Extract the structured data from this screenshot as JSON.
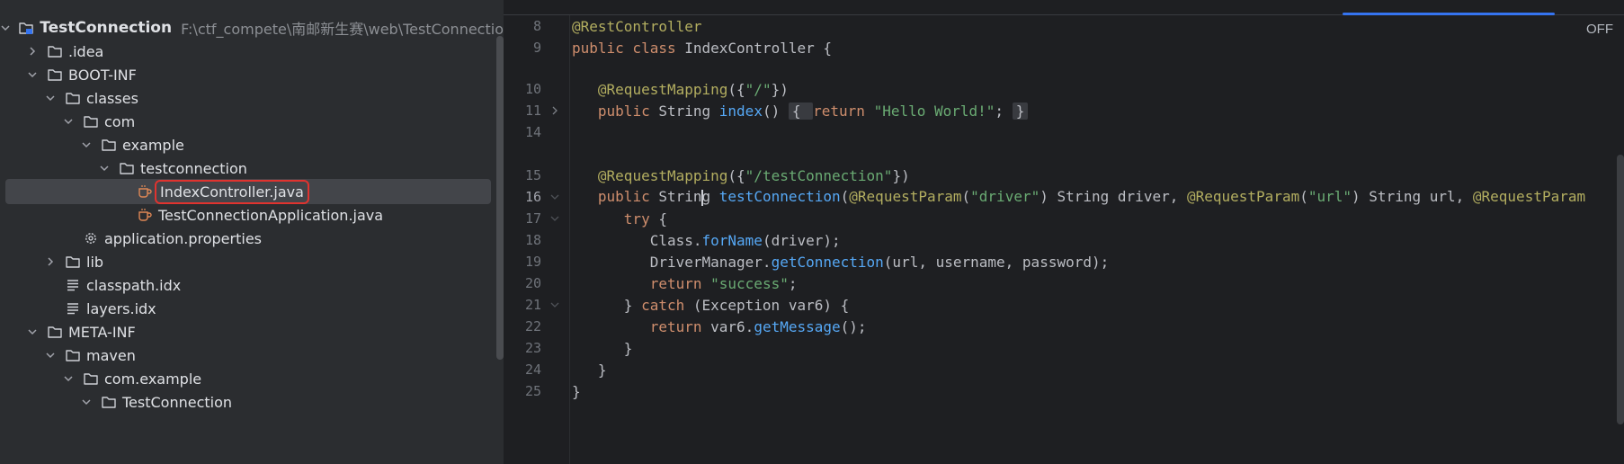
{
  "project_tree": {
    "items": [
      {
        "label": "TestConnection",
        "path": "F:\\ctf_compete\\南邮新生赛\\web\\TestConnectio",
        "icon": "module-folder-icon",
        "expanded": true,
        "depth": 0
      },
      {
        "label": ".idea",
        "icon": "folder-icon",
        "expanded": false,
        "depth": 1
      },
      {
        "label": "BOOT-INF",
        "icon": "folder-icon",
        "expanded": true,
        "depth": 1
      },
      {
        "label": "classes",
        "icon": "folder-icon",
        "expanded": true,
        "depth": 2
      },
      {
        "label": "com",
        "icon": "folder-icon",
        "expanded": true,
        "depth": 3
      },
      {
        "label": "example",
        "icon": "folder-icon",
        "expanded": true,
        "depth": 4
      },
      {
        "label": "testconnection",
        "icon": "folder-icon",
        "expanded": true,
        "depth": 5
      },
      {
        "label": "IndexController.java",
        "icon": "java-class-icon",
        "depth": 6,
        "selected": true,
        "highlighted": true
      },
      {
        "label": "TestConnectionApplication.java",
        "icon": "java-class-icon",
        "depth": 6
      },
      {
        "label": "application.properties",
        "icon": "settings-file-icon",
        "depth": 3
      },
      {
        "label": "lib",
        "icon": "folder-icon",
        "expanded": false,
        "depth": 2
      },
      {
        "label": "classpath.idx",
        "icon": "text-file-icon",
        "depth": 2
      },
      {
        "label": "layers.idx",
        "icon": "text-file-icon",
        "depth": 2
      },
      {
        "label": "META-INF",
        "icon": "folder-icon",
        "expanded": true,
        "depth": 1
      },
      {
        "label": "maven",
        "icon": "folder-icon",
        "expanded": true,
        "depth": 2
      },
      {
        "label": "com.example",
        "icon": "folder-icon",
        "expanded": true,
        "depth": 3
      },
      {
        "label": "TestConnection",
        "icon": "folder-icon",
        "expanded": true,
        "depth": 4
      }
    ]
  },
  "editor": {
    "reader_mode_label": "OFF",
    "current_line": "16",
    "lines": [
      {
        "no": "8",
        "tokens": [
          [
            "ann",
            "@RestController"
          ]
        ]
      },
      {
        "no": "9",
        "tokens": [
          [
            "kw",
            "public class "
          ],
          [
            "",
            "IndexController {"
          ]
        ]
      },
      {
        "no": "",
        "tokens": []
      },
      {
        "no": "10",
        "tokens": [
          [
            "",
            "   "
          ],
          [
            "ann",
            "@RequestMapping"
          ],
          [
            "",
            "({"
          ],
          [
            "str",
            "\"/\""
          ],
          [
            "",
            "})"
          ]
        ]
      },
      {
        "no": "11",
        "fold": "right",
        "tokens": [
          [
            "",
            "   "
          ],
          [
            "kw",
            "public "
          ],
          [
            "",
            "String "
          ],
          [
            "fn",
            "index"
          ],
          [
            "",
            "() "
          ],
          [
            "foldbox",
            "{ "
          ],
          [
            "kw",
            "return "
          ],
          [
            "str",
            "\"Hello World!\""
          ],
          [
            "",
            "; "
          ],
          [
            "foldbox",
            "}"
          ]
        ]
      },
      {
        "no": "14",
        "tokens": []
      },
      {
        "no": "",
        "tokens": []
      },
      {
        "no": "15",
        "tokens": [
          [
            "",
            "   "
          ],
          [
            "ann",
            "@RequestMapping"
          ],
          [
            "",
            "({"
          ],
          [
            "str",
            "\"/testConnection\""
          ],
          [
            "",
            "})"
          ]
        ]
      },
      {
        "no": "16",
        "fold": "down",
        "tokens": [
          [
            "",
            "   "
          ],
          [
            "kw",
            "public "
          ],
          [
            "",
            "Strin"
          ],
          [
            "caret",
            ""
          ],
          [
            "",
            "g "
          ],
          [
            "fn",
            "testConnection"
          ],
          [
            "",
            "("
          ],
          [
            "ann",
            "@RequestParam"
          ],
          [
            "",
            "("
          ],
          [
            "str",
            "\"driver\""
          ],
          [
            "",
            ") String driver, "
          ],
          [
            "ann",
            "@RequestParam"
          ],
          [
            "",
            "("
          ],
          [
            "str",
            "\"url\""
          ],
          [
            "",
            ") String url, "
          ],
          [
            "ann",
            "@RequestParam"
          ]
        ]
      },
      {
        "no": "17",
        "fold": "down",
        "tokens": [
          [
            "",
            "      "
          ],
          [
            "kw",
            "try "
          ],
          [
            "",
            "{"
          ]
        ]
      },
      {
        "no": "18",
        "tokens": [
          [
            "",
            "         Class."
          ],
          [
            "fn",
            "forName"
          ],
          [
            "",
            "(driver);"
          ]
        ]
      },
      {
        "no": "19",
        "tokens": [
          [
            "",
            "         DriverManager."
          ],
          [
            "fn",
            "getConnection"
          ],
          [
            "",
            "(url, username, password);"
          ]
        ]
      },
      {
        "no": "20",
        "tokens": [
          [
            "",
            "         "
          ],
          [
            "kw",
            "return "
          ],
          [
            "str",
            "\"success\""
          ],
          [
            "",
            ";"
          ]
        ]
      },
      {
        "no": "21",
        "fold": "down",
        "tokens": [
          [
            "",
            "      } "
          ],
          [
            "kw",
            "catch "
          ],
          [
            "",
            "(Exception var6) {"
          ]
        ]
      },
      {
        "no": "22",
        "tokens": [
          [
            "",
            "         "
          ],
          [
            "kw",
            "return "
          ],
          [
            "",
            "var6."
          ],
          [
            "fn",
            "getMessage"
          ],
          [
            "",
            "();"
          ]
        ]
      },
      {
        "no": "23",
        "tokens": [
          [
            "",
            "      }"
          ]
        ]
      },
      {
        "no": "24",
        "tokens": [
          [
            "",
            "   }"
          ]
        ]
      },
      {
        "no": "25",
        "tokens": [
          [
            "",
            "}"
          ]
        ]
      }
    ]
  }
}
